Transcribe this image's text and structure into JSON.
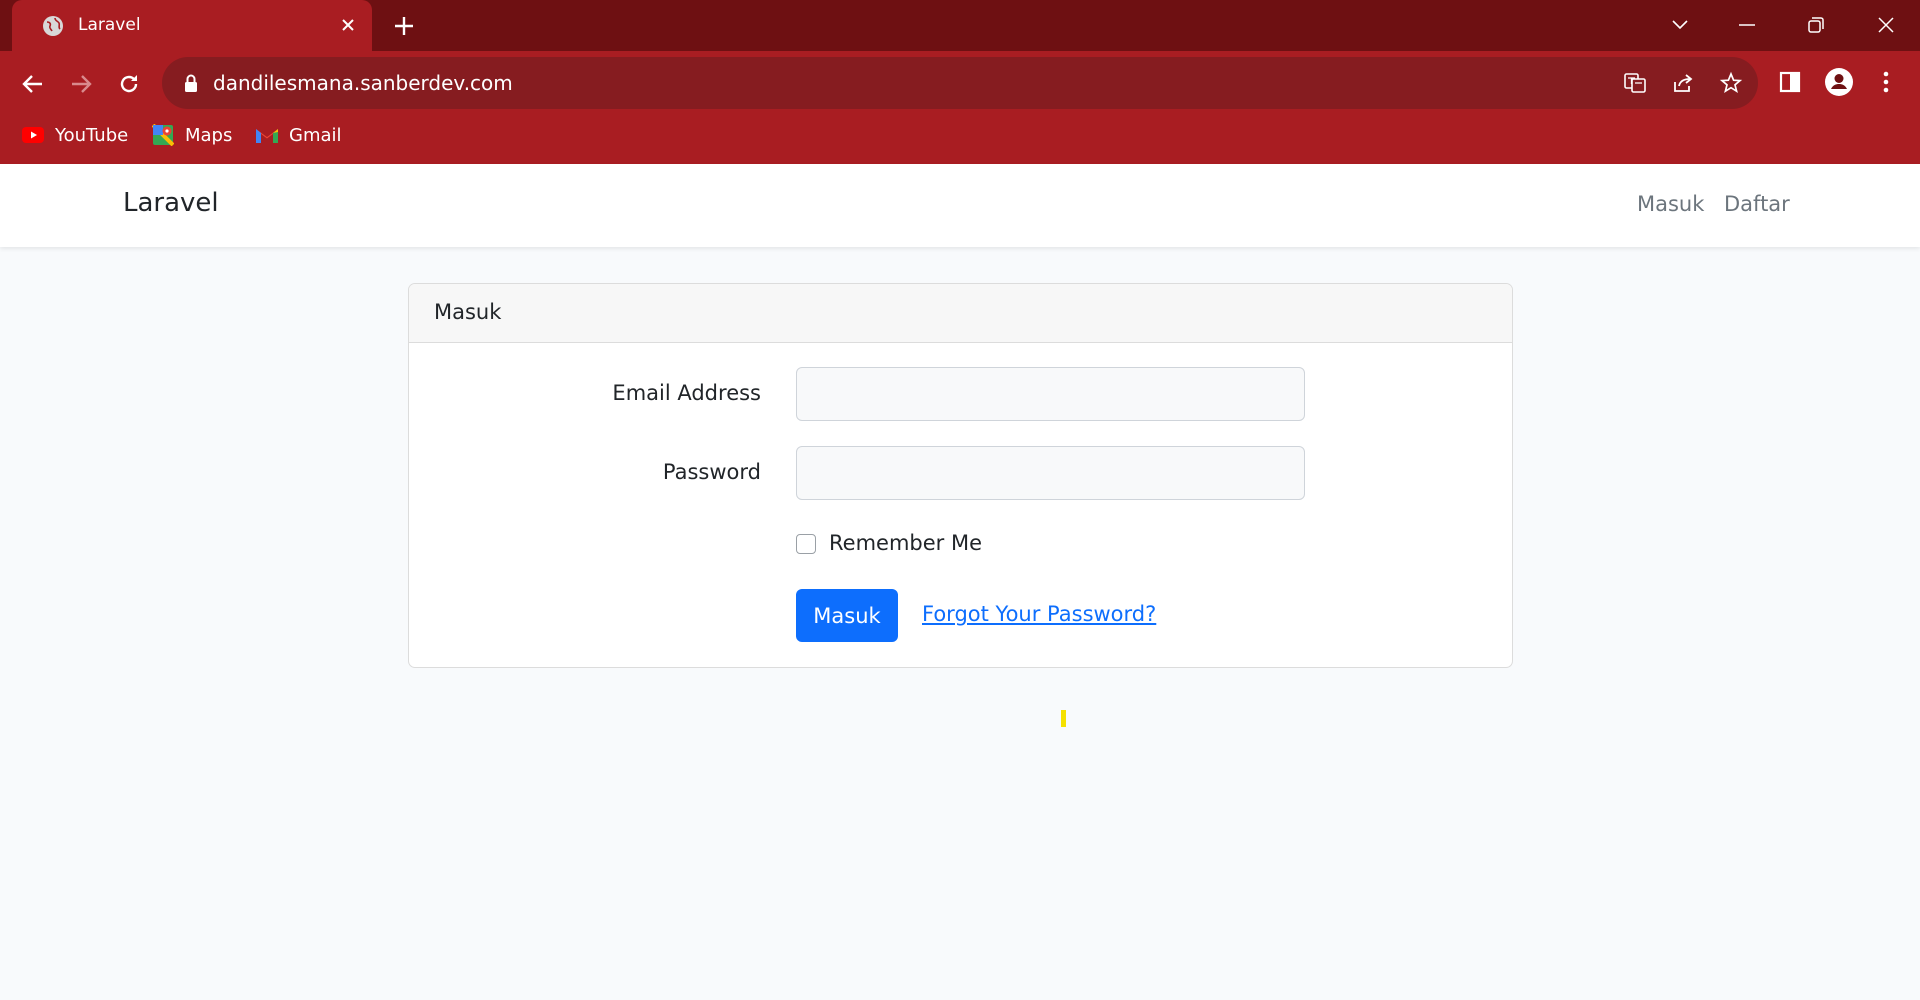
{
  "browser": {
    "tab": {
      "title": "Laravel",
      "favicon": "globe-icon"
    },
    "url": "dandilesmana.sanberdev.com",
    "bookmarks": [
      {
        "label": "YouTube",
        "icon": "youtube-icon"
      },
      {
        "label": "Maps",
        "icon": "maps-icon"
      },
      {
        "label": "Gmail",
        "icon": "gmail-icon"
      }
    ],
    "colors": {
      "frame": "#6e1012",
      "toolbar": "#a91d22",
      "omnibox": "#861c20"
    }
  },
  "navbar": {
    "brand": "Laravel",
    "links": [
      "Masuk",
      "Daftar"
    ]
  },
  "login_card": {
    "header": "Masuk",
    "email_label": "Email Address",
    "email_value": "",
    "password_label": "Password",
    "password_value": "",
    "remember_label": "Remember Me",
    "remember_checked": false,
    "submit_label": "Masuk",
    "forgot_label": "Forgot Your Password?"
  },
  "colors": {
    "primary": "#0d6efd",
    "page_bg": "#f8fafc"
  }
}
